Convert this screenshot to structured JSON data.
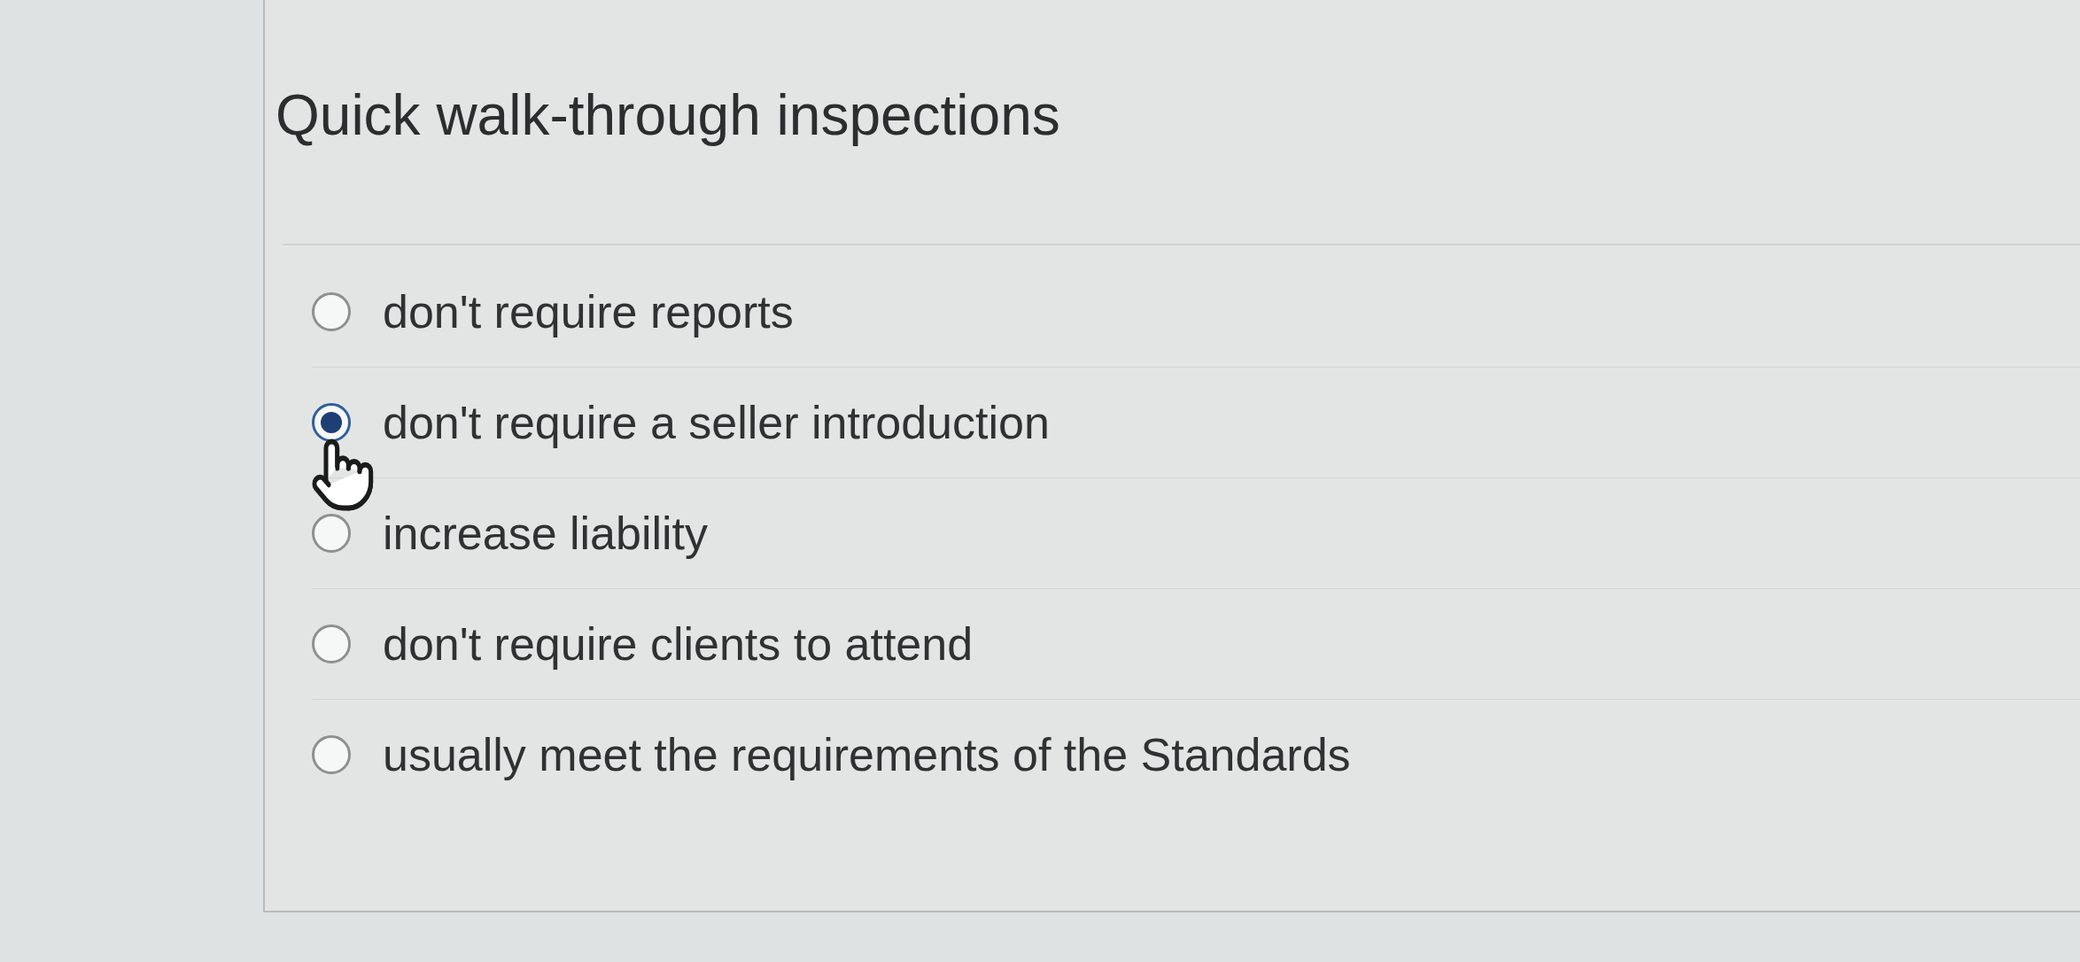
{
  "question": {
    "title": "Quick walk-through inspections"
  },
  "options": [
    {
      "label": "don't require reports",
      "selected": false
    },
    {
      "label": "don't require a seller introduction",
      "selected": true
    },
    {
      "label": "increase liability",
      "selected": false
    },
    {
      "label": "don't require clients to attend",
      "selected": false
    },
    {
      "label": "usually meet the requirements of the Standards",
      "selected": false
    }
  ]
}
